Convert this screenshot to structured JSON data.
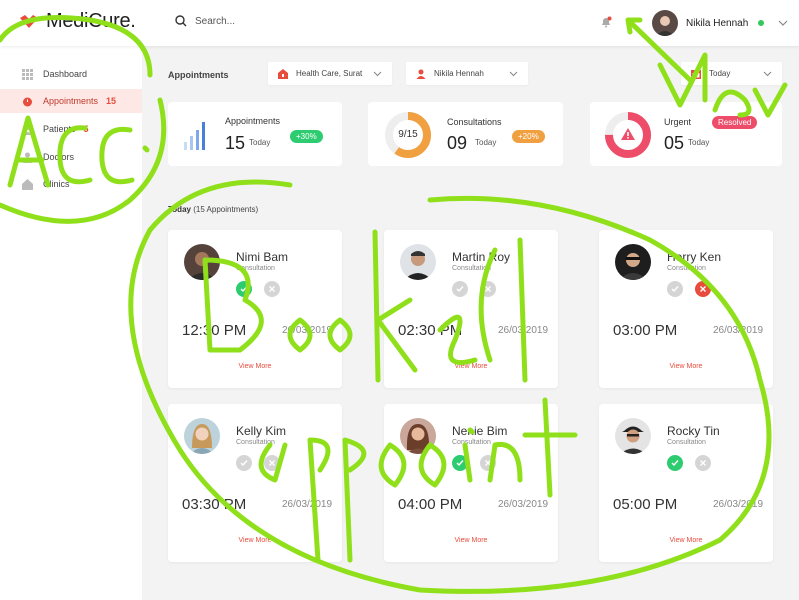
{
  "header": {
    "logo_text": "MediCure.",
    "search_placeholder": "Search...",
    "user_name": "Nikila Hennah",
    "icons": [
      "logo-mark",
      "search-icon",
      "bell-icon",
      "chevron-down-icon"
    ]
  },
  "sidebar": {
    "items": [
      {
        "label": "Dashboard",
        "badge": "",
        "icon": "grid-icon"
      },
      {
        "label": "Appointments",
        "badge": "15",
        "icon": "alarm-clock-icon"
      },
      {
        "label": "Patients",
        "badge": "5",
        "icon": "users-icon"
      },
      {
        "label": "Doctors",
        "badge": "",
        "icon": "doctor-icon"
      },
      {
        "label": "Clinics",
        "badge": "",
        "icon": "clinic-icon"
      }
    ]
  },
  "filters": {
    "title": "Appointments",
    "clinic": "Health Care, Surat",
    "doctor": "Nikila Hennah",
    "date": "Today"
  },
  "stats": [
    {
      "title": "Appointments",
      "value": "15",
      "sub": "Today",
      "badge": "+30%",
      "badge_color": "#2ecc71"
    },
    {
      "title": "Consultations",
      "value": "09",
      "sub": "Today",
      "badge": "+20%",
      "badge_color": "#f0a040",
      "ring_label": "9/15",
      "progress": 0.6
    },
    {
      "title": "Urgent",
      "value": "05",
      "sub": "Today",
      "badge": "Resolved",
      "badge_color": "#ee4d6a",
      "progress": 0.75
    }
  ],
  "today": {
    "label": "Today",
    "count": "(15 Appointments)"
  },
  "appointments": [
    {
      "name": "Nimi Bam",
      "type": "Consultation",
      "time": "12:30 PM",
      "date": "26/03/2019",
      "more": "View More",
      "accepted": true,
      "rejected": false
    },
    {
      "name": "Martin Roy",
      "type": "Consultation",
      "time": "02:30 PM",
      "date": "26/03/2019",
      "more": "View More",
      "accepted": false,
      "rejected": false
    },
    {
      "name": "Herry Ken",
      "type": "Consultation",
      "time": "03:00 PM",
      "date": "26/03/2019",
      "more": "View More",
      "accepted": false,
      "rejected": true
    },
    {
      "name": "Kelly Kim",
      "type": "Consultation",
      "time": "03:30 PM",
      "date": "26/03/2019",
      "more": "View More",
      "accepted": false,
      "rejected": false
    },
    {
      "name": "Nenie Bim",
      "type": "Consultation",
      "time": "04:00 PM",
      "date": "26/03/2019",
      "more": "View More",
      "accepted": true,
      "rejected": false
    },
    {
      "name": "Rocky Tin",
      "type": "Consultation",
      "time": "05:00 PM",
      "date": "26/03/2019",
      "more": "View More",
      "accepted": true,
      "rejected": false
    }
  ],
  "colors": {
    "accent": "#e74c3c",
    "success": "#2ecc71",
    "annotation": "#8fe01a"
  }
}
